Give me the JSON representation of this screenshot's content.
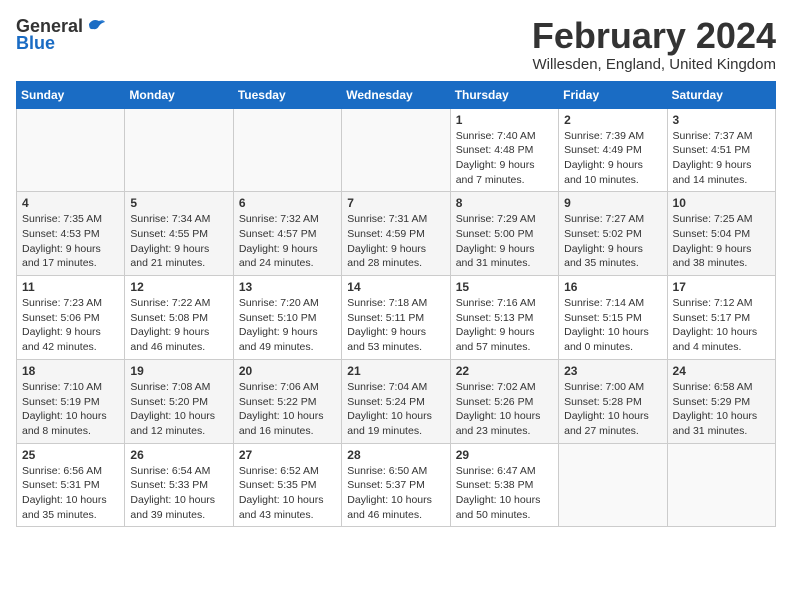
{
  "header": {
    "logo_general": "General",
    "logo_blue": "Blue",
    "month_title": "February 2024",
    "location": "Willesden, England, United Kingdom"
  },
  "days_of_week": [
    "Sunday",
    "Monday",
    "Tuesday",
    "Wednesday",
    "Thursday",
    "Friday",
    "Saturday"
  ],
  "weeks": [
    [
      {
        "day": "",
        "sunrise": "",
        "sunset": "",
        "daylight": "",
        "empty": true
      },
      {
        "day": "",
        "sunrise": "",
        "sunset": "",
        "daylight": "",
        "empty": true
      },
      {
        "day": "",
        "sunrise": "",
        "sunset": "",
        "daylight": "",
        "empty": true
      },
      {
        "day": "",
        "sunrise": "",
        "sunset": "",
        "daylight": "",
        "empty": true
      },
      {
        "day": "1",
        "sunrise": "7:40 AM",
        "sunset": "4:48 PM",
        "daylight": "9 hours and 7 minutes.",
        "empty": false
      },
      {
        "day": "2",
        "sunrise": "7:39 AM",
        "sunset": "4:49 PM",
        "daylight": "9 hours and 10 minutes.",
        "empty": false
      },
      {
        "day": "3",
        "sunrise": "7:37 AM",
        "sunset": "4:51 PM",
        "daylight": "9 hours and 14 minutes.",
        "empty": false
      }
    ],
    [
      {
        "day": "4",
        "sunrise": "7:35 AM",
        "sunset": "4:53 PM",
        "daylight": "9 hours and 17 minutes.",
        "empty": false
      },
      {
        "day": "5",
        "sunrise": "7:34 AM",
        "sunset": "4:55 PM",
        "daylight": "9 hours and 21 minutes.",
        "empty": false
      },
      {
        "day": "6",
        "sunrise": "7:32 AM",
        "sunset": "4:57 PM",
        "daylight": "9 hours and 24 minutes.",
        "empty": false
      },
      {
        "day": "7",
        "sunrise": "7:31 AM",
        "sunset": "4:59 PM",
        "daylight": "9 hours and 28 minutes.",
        "empty": false
      },
      {
        "day": "8",
        "sunrise": "7:29 AM",
        "sunset": "5:00 PM",
        "daylight": "9 hours and 31 minutes.",
        "empty": false
      },
      {
        "day": "9",
        "sunrise": "7:27 AM",
        "sunset": "5:02 PM",
        "daylight": "9 hours and 35 minutes.",
        "empty": false
      },
      {
        "day": "10",
        "sunrise": "7:25 AM",
        "sunset": "5:04 PM",
        "daylight": "9 hours and 38 minutes.",
        "empty": false
      }
    ],
    [
      {
        "day": "11",
        "sunrise": "7:23 AM",
        "sunset": "5:06 PM",
        "daylight": "9 hours and 42 minutes.",
        "empty": false
      },
      {
        "day": "12",
        "sunrise": "7:22 AM",
        "sunset": "5:08 PM",
        "daylight": "9 hours and 46 minutes.",
        "empty": false
      },
      {
        "day": "13",
        "sunrise": "7:20 AM",
        "sunset": "5:10 PM",
        "daylight": "9 hours and 49 minutes.",
        "empty": false
      },
      {
        "day": "14",
        "sunrise": "7:18 AM",
        "sunset": "5:11 PM",
        "daylight": "9 hours and 53 minutes.",
        "empty": false
      },
      {
        "day": "15",
        "sunrise": "7:16 AM",
        "sunset": "5:13 PM",
        "daylight": "9 hours and 57 minutes.",
        "empty": false
      },
      {
        "day": "16",
        "sunrise": "7:14 AM",
        "sunset": "5:15 PM",
        "daylight": "10 hours and 0 minutes.",
        "empty": false
      },
      {
        "day": "17",
        "sunrise": "7:12 AM",
        "sunset": "5:17 PM",
        "daylight": "10 hours and 4 minutes.",
        "empty": false
      }
    ],
    [
      {
        "day": "18",
        "sunrise": "7:10 AM",
        "sunset": "5:19 PM",
        "daylight": "10 hours and 8 minutes.",
        "empty": false
      },
      {
        "day": "19",
        "sunrise": "7:08 AM",
        "sunset": "5:20 PM",
        "daylight": "10 hours and 12 minutes.",
        "empty": false
      },
      {
        "day": "20",
        "sunrise": "7:06 AM",
        "sunset": "5:22 PM",
        "daylight": "10 hours and 16 minutes.",
        "empty": false
      },
      {
        "day": "21",
        "sunrise": "7:04 AM",
        "sunset": "5:24 PM",
        "daylight": "10 hours and 19 minutes.",
        "empty": false
      },
      {
        "day": "22",
        "sunrise": "7:02 AM",
        "sunset": "5:26 PM",
        "daylight": "10 hours and 23 minutes.",
        "empty": false
      },
      {
        "day": "23",
        "sunrise": "7:00 AM",
        "sunset": "5:28 PM",
        "daylight": "10 hours and 27 minutes.",
        "empty": false
      },
      {
        "day": "24",
        "sunrise": "6:58 AM",
        "sunset": "5:29 PM",
        "daylight": "10 hours and 31 minutes.",
        "empty": false
      }
    ],
    [
      {
        "day": "25",
        "sunrise": "6:56 AM",
        "sunset": "5:31 PM",
        "daylight": "10 hours and 35 minutes.",
        "empty": false
      },
      {
        "day": "26",
        "sunrise": "6:54 AM",
        "sunset": "5:33 PM",
        "daylight": "10 hours and 39 minutes.",
        "empty": false
      },
      {
        "day": "27",
        "sunrise": "6:52 AM",
        "sunset": "5:35 PM",
        "daylight": "10 hours and 43 minutes.",
        "empty": false
      },
      {
        "day": "28",
        "sunrise": "6:50 AM",
        "sunset": "5:37 PM",
        "daylight": "10 hours and 46 minutes.",
        "empty": false
      },
      {
        "day": "29",
        "sunrise": "6:47 AM",
        "sunset": "5:38 PM",
        "daylight": "10 hours and 50 minutes.",
        "empty": false
      },
      {
        "day": "",
        "sunrise": "",
        "sunset": "",
        "daylight": "",
        "empty": true
      },
      {
        "day": "",
        "sunrise": "",
        "sunset": "",
        "daylight": "",
        "empty": true
      }
    ]
  ],
  "labels": {
    "sunrise": "Sunrise:",
    "sunset": "Sunset:",
    "daylight": "Daylight:"
  }
}
